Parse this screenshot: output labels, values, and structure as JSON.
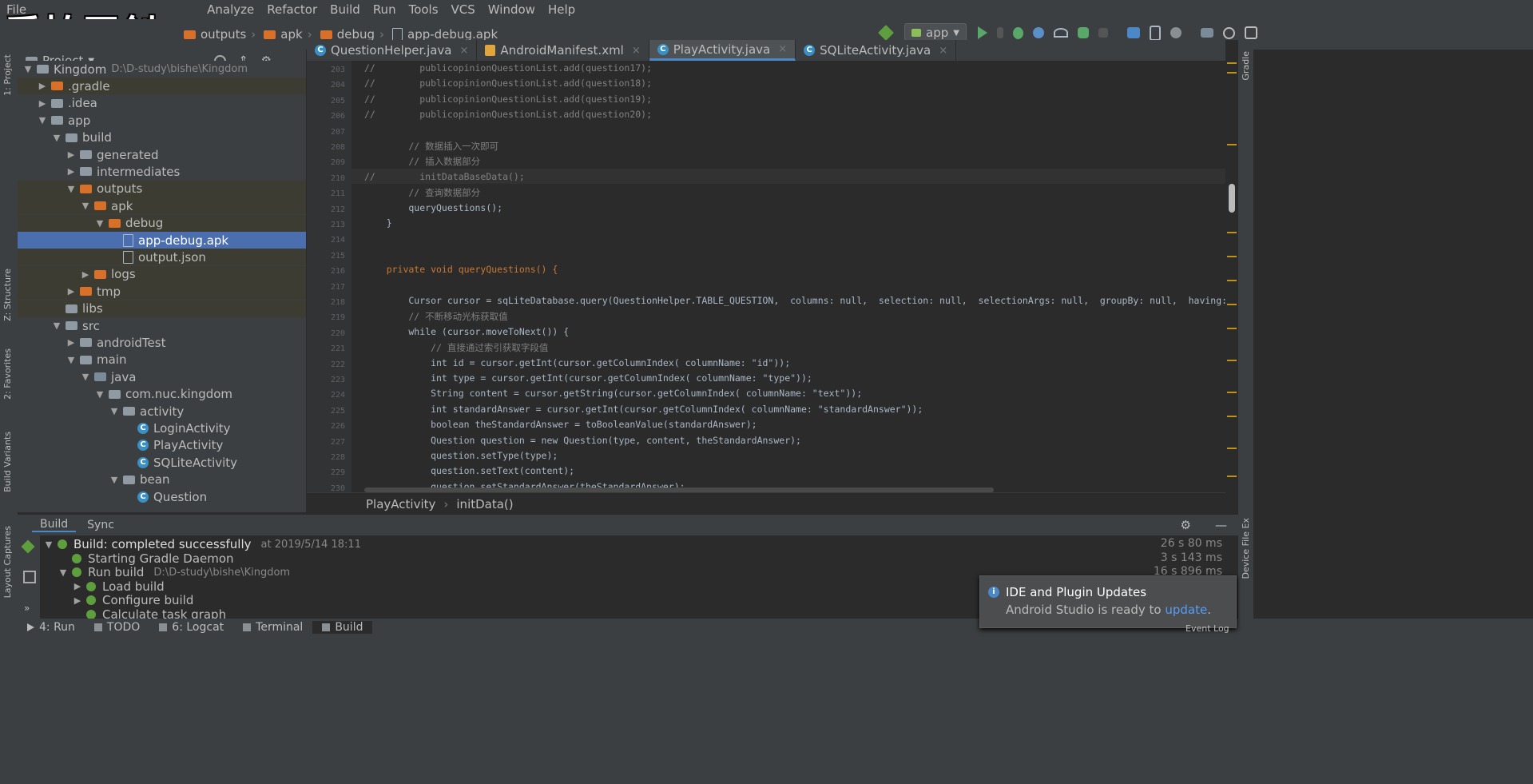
{
  "watermark": "爱拍原创",
  "menu": [
    "File",
    "Analyze",
    "Refactor",
    "Build",
    "Run",
    "Tools",
    "VCS",
    "Window",
    "Help"
  ],
  "breadcrumb": [
    "outputs",
    "apk",
    "debug",
    "app-debug.apk"
  ],
  "run_config": "app",
  "project_panel": {
    "title": "Project",
    "tree": [
      {
        "label": "Kingdom",
        "path": "D:\\D-study\\bishe\\Kingdom",
        "depth": 0,
        "arrow": "▼",
        "icon": "folder-gray"
      },
      {
        "label": ".gradle",
        "depth": 1,
        "arrow": "▶",
        "icon": "folder-orange",
        "hl": true
      },
      {
        "label": ".idea",
        "depth": 1,
        "arrow": "▶",
        "icon": "folder-gray"
      },
      {
        "label": "app",
        "depth": 1,
        "arrow": "▼",
        "icon": "folder-gray"
      },
      {
        "label": "build",
        "depth": 2,
        "arrow": "▼",
        "icon": "folder-gray"
      },
      {
        "label": "generated",
        "depth": 3,
        "arrow": "▶",
        "icon": "folder-gray"
      },
      {
        "label": "intermediates",
        "depth": 3,
        "arrow": "▶",
        "icon": "folder-gray"
      },
      {
        "label": "outputs",
        "depth": 3,
        "arrow": "▼",
        "icon": "folder-orange",
        "hl": true
      },
      {
        "label": "apk",
        "depth": 4,
        "arrow": "▼",
        "icon": "folder-orange",
        "hl": true
      },
      {
        "label": "debug",
        "depth": 5,
        "arrow": "▼",
        "icon": "folder-orange",
        "hl": true
      },
      {
        "label": "app-debug.apk",
        "depth": 6,
        "arrow": "",
        "icon": "file",
        "sel": true
      },
      {
        "label": "output.json",
        "depth": 6,
        "arrow": "",
        "icon": "file",
        "hl": true
      },
      {
        "label": "logs",
        "depth": 4,
        "arrow": "▶",
        "icon": "folder-orange",
        "hl": true
      },
      {
        "label": "tmp",
        "depth": 3,
        "arrow": "▶",
        "icon": "folder-orange",
        "hl": true
      },
      {
        "label": "libs",
        "depth": 2,
        "arrow": "",
        "icon": "folder-gray",
        "hl": true
      },
      {
        "label": "src",
        "depth": 2,
        "arrow": "▼",
        "icon": "folder-gray"
      },
      {
        "label": "androidTest",
        "depth": 3,
        "arrow": "▶",
        "icon": "folder-gray"
      },
      {
        "label": "main",
        "depth": 3,
        "arrow": "▼",
        "icon": "folder-gray"
      },
      {
        "label": "java",
        "depth": 4,
        "arrow": "▼",
        "icon": "folder-blue"
      },
      {
        "label": "com.nuc.kingdom",
        "depth": 5,
        "arrow": "▼",
        "icon": "folder-gray"
      },
      {
        "label": "activity",
        "depth": 6,
        "arrow": "▼",
        "icon": "folder-gray"
      },
      {
        "label": "LoginActivity",
        "depth": 7,
        "arrow": "",
        "icon": "class"
      },
      {
        "label": "PlayActivity",
        "depth": 7,
        "arrow": "",
        "icon": "class"
      },
      {
        "label": "SQLiteActivity",
        "depth": 7,
        "arrow": "",
        "icon": "class"
      },
      {
        "label": "bean",
        "depth": 6,
        "arrow": "▼",
        "icon": "folder-gray"
      },
      {
        "label": "Question",
        "depth": 7,
        "arrow": "",
        "icon": "class"
      }
    ]
  },
  "editor_tabs": [
    {
      "label": "QuestionHelper.java",
      "icon": "class",
      "active": false
    },
    {
      "label": "AndroidManifest.xml",
      "icon": "xml",
      "active": false
    },
    {
      "label": "PlayActivity.java",
      "icon": "class",
      "active": true
    },
    {
      "label": "SQLiteActivity.java",
      "icon": "class",
      "active": false
    }
  ],
  "code_lines": [
    {
      "n": "203",
      "t": "//        publicopinionQuestionList.add(question17);"
    },
    {
      "n": "204",
      "t": "//        publicopinionQuestionList.add(question18);"
    },
    {
      "n": "205",
      "t": "//        publicopinionQuestionList.add(question19);"
    },
    {
      "n": "206",
      "t": "//        publicopinionQuestionList.add(question20);"
    },
    {
      "n": "207",
      "t": ""
    },
    {
      "n": "208",
      "t": "        // 数据插入一次即可"
    },
    {
      "n": "209",
      "t": "        // 插入数据部分"
    },
    {
      "n": "210",
      "t": "//        initDataBaseData();"
    },
    {
      "n": "211",
      "t": "        // 查询数据部分"
    },
    {
      "n": "212",
      "t": "        queryQuestions();"
    },
    {
      "n": "213",
      "t": "    }"
    },
    {
      "n": "214",
      "t": ""
    },
    {
      "n": "215",
      "t": ""
    },
    {
      "n": "216",
      "t": "    private void queryQuestions() {"
    },
    {
      "n": "217",
      "t": ""
    },
    {
      "n": "218",
      "t": "        Cursor cursor = sqLiteDatabase.query(QuestionHelper.TABLE_QUESTION,  columns: null,  selection: null,  selectionArgs: null,  groupBy: null,  having: null,  orderB"
    },
    {
      "n": "219",
      "t": "        // 不断移动光标获取值"
    },
    {
      "n": "220",
      "t": "        while (cursor.moveToNext()) {"
    },
    {
      "n": "221",
      "t": "            // 直接通过索引获取字段值"
    },
    {
      "n": "222",
      "t": "            int id = cursor.getInt(cursor.getColumnIndex( columnName: \"id\"));"
    },
    {
      "n": "223",
      "t": "            int type = cursor.getInt(cursor.getColumnIndex( columnName: \"type\"));"
    },
    {
      "n": "224",
      "t": "            String content = cursor.getString(cursor.getColumnIndex( columnName: \"text\"));"
    },
    {
      "n": "225",
      "t": "            int standardAnswer = cursor.getInt(cursor.getColumnIndex( columnName: \"standardAnswer\"));"
    },
    {
      "n": "226",
      "t": "            boolean theStandardAnswer = toBooleanValue(standardAnswer);"
    },
    {
      "n": "227",
      "t": "            Question question = new Question(type, content, theStandardAnswer);"
    },
    {
      "n": "228",
      "t": "            question.setType(type);"
    },
    {
      "n": "229",
      "t": "            question.setText(content);"
    },
    {
      "n": "230",
      "t": "            question.setStandardAnswer(theStandardAnswer);"
    }
  ],
  "editor_breadcrumb": [
    "PlayActivity",
    "initData()"
  ],
  "build_panel": {
    "tabs": [
      "Build",
      "Sync"
    ],
    "rows": [
      {
        "label": "Build: completed successfully",
        "meta": "at 2019/5/14 18:11",
        "time": "26 s 80 ms",
        "depth": 0,
        "arrow": "▼"
      },
      {
        "label": "Starting Gradle Daemon",
        "meta": "",
        "time": "3 s 143 ms",
        "depth": 1,
        "arrow": ""
      },
      {
        "label": "Run build",
        "meta": "D:\\D-study\\bishe\\Kingdom",
        "time": "16 s 896 ms",
        "depth": 1,
        "arrow": "▼"
      },
      {
        "label": "Load build",
        "meta": "",
        "time": "",
        "depth": 2,
        "arrow": "▶"
      },
      {
        "label": "Configure build",
        "meta": "",
        "time": "",
        "depth": 2,
        "arrow": "▶"
      },
      {
        "label": "Calculate task graph",
        "meta": "",
        "time": "",
        "depth": 2,
        "arrow": ""
      }
    ]
  },
  "bottom_tabs": [
    "4: Run",
    "TODO",
    "6: Logcat",
    "Terminal",
    "Build"
  ],
  "left_strip": [
    "1: Project",
    "Z: Structure",
    "2: Favorites",
    "Build Variants",
    "Layout Captures"
  ],
  "right_strip": [
    "Gradle",
    "Device File Ex"
  ],
  "notification": {
    "title": "IDE and Plugin Updates",
    "text": "Android Studio is ready to",
    "link": "update"
  },
  "event_log": "Event Log"
}
